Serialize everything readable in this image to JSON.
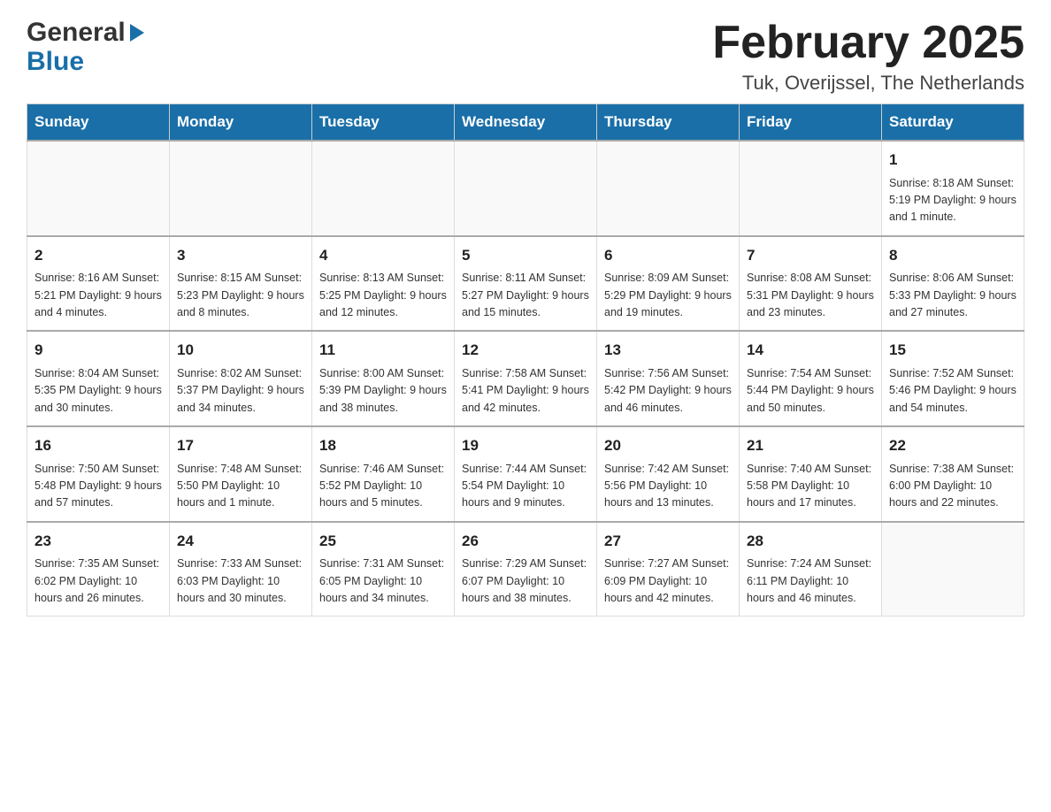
{
  "header": {
    "logo_general": "General",
    "logo_blue": "Blue",
    "main_title": "February 2025",
    "subtitle": "Tuk, Overijssel, The Netherlands"
  },
  "days_of_week": [
    "Sunday",
    "Monday",
    "Tuesday",
    "Wednesday",
    "Thursday",
    "Friday",
    "Saturday"
  ],
  "weeks": [
    [
      {
        "day": "",
        "info": ""
      },
      {
        "day": "",
        "info": ""
      },
      {
        "day": "",
        "info": ""
      },
      {
        "day": "",
        "info": ""
      },
      {
        "day": "",
        "info": ""
      },
      {
        "day": "",
        "info": ""
      },
      {
        "day": "1",
        "info": "Sunrise: 8:18 AM\nSunset: 5:19 PM\nDaylight: 9 hours and 1 minute."
      }
    ],
    [
      {
        "day": "2",
        "info": "Sunrise: 8:16 AM\nSunset: 5:21 PM\nDaylight: 9 hours and 4 minutes."
      },
      {
        "day": "3",
        "info": "Sunrise: 8:15 AM\nSunset: 5:23 PM\nDaylight: 9 hours and 8 minutes."
      },
      {
        "day": "4",
        "info": "Sunrise: 8:13 AM\nSunset: 5:25 PM\nDaylight: 9 hours and 12 minutes."
      },
      {
        "day": "5",
        "info": "Sunrise: 8:11 AM\nSunset: 5:27 PM\nDaylight: 9 hours and 15 minutes."
      },
      {
        "day": "6",
        "info": "Sunrise: 8:09 AM\nSunset: 5:29 PM\nDaylight: 9 hours and 19 minutes."
      },
      {
        "day": "7",
        "info": "Sunrise: 8:08 AM\nSunset: 5:31 PM\nDaylight: 9 hours and 23 minutes."
      },
      {
        "day": "8",
        "info": "Sunrise: 8:06 AM\nSunset: 5:33 PM\nDaylight: 9 hours and 27 minutes."
      }
    ],
    [
      {
        "day": "9",
        "info": "Sunrise: 8:04 AM\nSunset: 5:35 PM\nDaylight: 9 hours and 30 minutes."
      },
      {
        "day": "10",
        "info": "Sunrise: 8:02 AM\nSunset: 5:37 PM\nDaylight: 9 hours and 34 minutes."
      },
      {
        "day": "11",
        "info": "Sunrise: 8:00 AM\nSunset: 5:39 PM\nDaylight: 9 hours and 38 minutes."
      },
      {
        "day": "12",
        "info": "Sunrise: 7:58 AM\nSunset: 5:41 PM\nDaylight: 9 hours and 42 minutes."
      },
      {
        "day": "13",
        "info": "Sunrise: 7:56 AM\nSunset: 5:42 PM\nDaylight: 9 hours and 46 minutes."
      },
      {
        "day": "14",
        "info": "Sunrise: 7:54 AM\nSunset: 5:44 PM\nDaylight: 9 hours and 50 minutes."
      },
      {
        "day": "15",
        "info": "Sunrise: 7:52 AM\nSunset: 5:46 PM\nDaylight: 9 hours and 54 minutes."
      }
    ],
    [
      {
        "day": "16",
        "info": "Sunrise: 7:50 AM\nSunset: 5:48 PM\nDaylight: 9 hours and 57 minutes."
      },
      {
        "day": "17",
        "info": "Sunrise: 7:48 AM\nSunset: 5:50 PM\nDaylight: 10 hours and 1 minute."
      },
      {
        "day": "18",
        "info": "Sunrise: 7:46 AM\nSunset: 5:52 PM\nDaylight: 10 hours and 5 minutes."
      },
      {
        "day": "19",
        "info": "Sunrise: 7:44 AM\nSunset: 5:54 PM\nDaylight: 10 hours and 9 minutes."
      },
      {
        "day": "20",
        "info": "Sunrise: 7:42 AM\nSunset: 5:56 PM\nDaylight: 10 hours and 13 minutes."
      },
      {
        "day": "21",
        "info": "Sunrise: 7:40 AM\nSunset: 5:58 PM\nDaylight: 10 hours and 17 minutes."
      },
      {
        "day": "22",
        "info": "Sunrise: 7:38 AM\nSunset: 6:00 PM\nDaylight: 10 hours and 22 minutes."
      }
    ],
    [
      {
        "day": "23",
        "info": "Sunrise: 7:35 AM\nSunset: 6:02 PM\nDaylight: 10 hours and 26 minutes."
      },
      {
        "day": "24",
        "info": "Sunrise: 7:33 AM\nSunset: 6:03 PM\nDaylight: 10 hours and 30 minutes."
      },
      {
        "day": "25",
        "info": "Sunrise: 7:31 AM\nSunset: 6:05 PM\nDaylight: 10 hours and 34 minutes."
      },
      {
        "day": "26",
        "info": "Sunrise: 7:29 AM\nSunset: 6:07 PM\nDaylight: 10 hours and 38 minutes."
      },
      {
        "day": "27",
        "info": "Sunrise: 7:27 AM\nSunset: 6:09 PM\nDaylight: 10 hours and 42 minutes."
      },
      {
        "day": "28",
        "info": "Sunrise: 7:24 AM\nSunset: 6:11 PM\nDaylight: 10 hours and 46 minutes."
      },
      {
        "day": "",
        "info": ""
      }
    ]
  ]
}
